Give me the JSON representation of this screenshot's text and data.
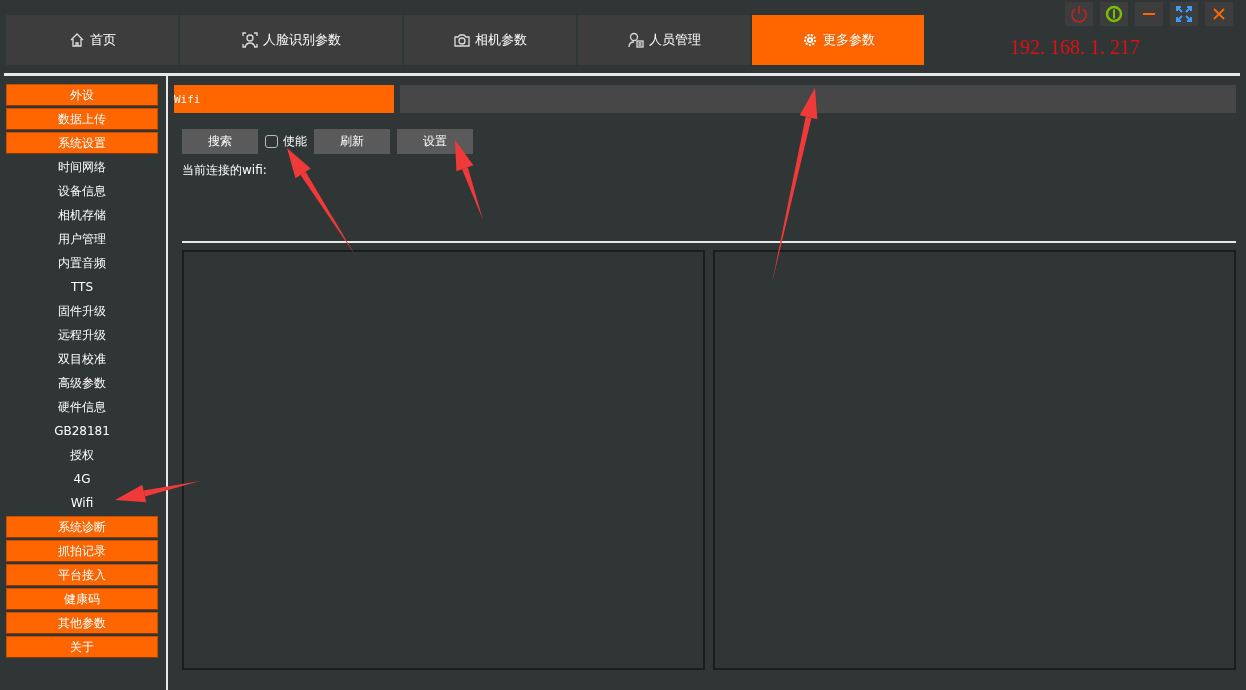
{
  "tabs": [
    {
      "label": "首页",
      "kind": "home",
      "selected": false
    },
    {
      "label": "人脸识别参数",
      "kind": "face",
      "selected": false
    },
    {
      "label": "相机参数",
      "kind": "camera",
      "selected": false
    },
    {
      "label": "人员管理",
      "kind": "person",
      "selected": false
    },
    {
      "label": "更多参数",
      "kind": "gear",
      "selected": true
    }
  ],
  "ip_address": "192. 168. 1. 217",
  "sidebar": {
    "items": [
      {
        "label": "外设",
        "kind": "group"
      },
      {
        "label": "数据上传",
        "kind": "group"
      },
      {
        "label": "系统设置",
        "kind": "group"
      },
      {
        "label": "时间网络",
        "kind": "sub"
      },
      {
        "label": "设备信息",
        "kind": "sub"
      },
      {
        "label": "相机存储",
        "kind": "sub"
      },
      {
        "label": "用户管理",
        "kind": "sub"
      },
      {
        "label": "内置音频",
        "kind": "sub"
      },
      {
        "label": "TTS",
        "kind": "sub"
      },
      {
        "label": "固件升级",
        "kind": "sub"
      },
      {
        "label": "远程升级",
        "kind": "sub"
      },
      {
        "label": "双目校准",
        "kind": "sub"
      },
      {
        "label": "高级参数",
        "kind": "sub"
      },
      {
        "label": "硬件信息",
        "kind": "sub"
      },
      {
        "label": "GB28181",
        "kind": "sub"
      },
      {
        "label": "授权",
        "kind": "sub"
      },
      {
        "label": "4G",
        "kind": "sub"
      },
      {
        "label": "Wifi",
        "kind": "sub"
      },
      {
        "label": "系统诊断",
        "kind": "group"
      },
      {
        "label": "抓拍记录",
        "kind": "group"
      },
      {
        "label": "平台接入",
        "kind": "group"
      },
      {
        "label": "健康码",
        "kind": "group"
      },
      {
        "label": "其他参数",
        "kind": "group"
      },
      {
        "label": "关于",
        "kind": "group"
      }
    ]
  },
  "panel": {
    "title": "Wifi",
    "search_button": "搜索",
    "enable": {
      "label": "使能",
      "checked": false
    },
    "refresh_button": "刷新",
    "set_button": "设置",
    "connected_label": "当前连接的wifi:"
  }
}
